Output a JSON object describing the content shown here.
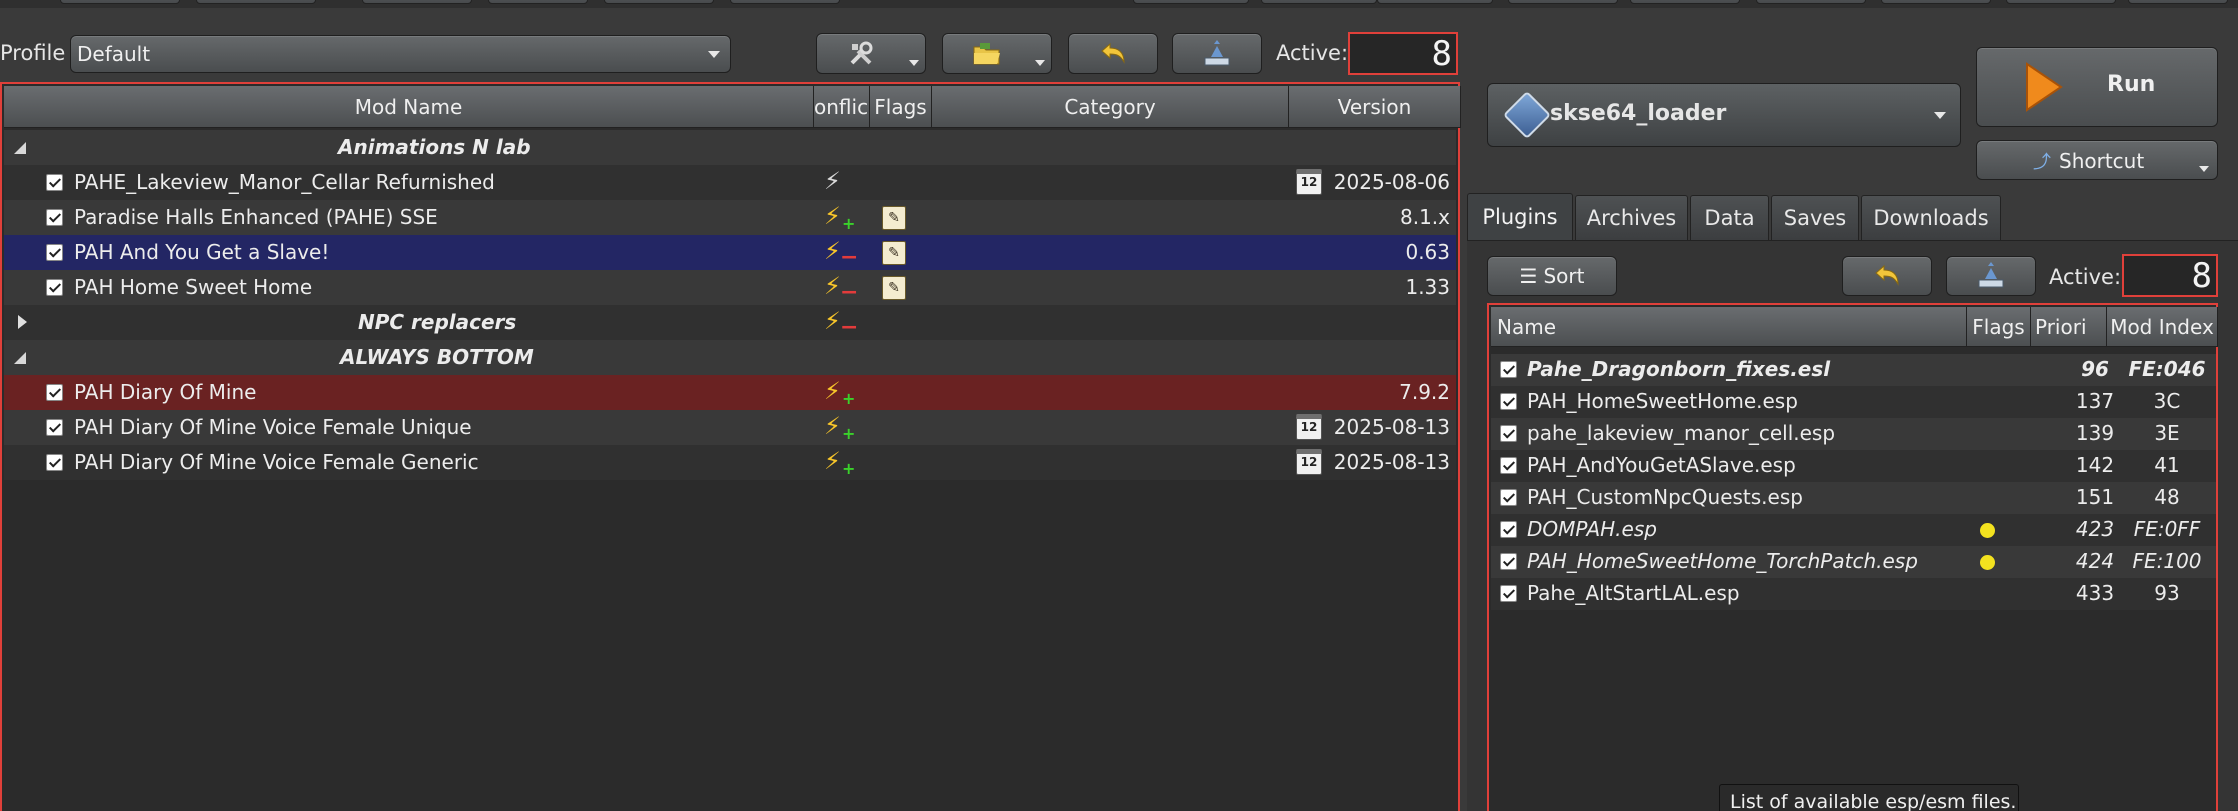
{
  "profile": {
    "label": "Profile",
    "selected": "Default"
  },
  "toolbar": {
    "tools_icon": "tools-icon",
    "folder_icon": "folder-icon",
    "undo_icon": "undo-arrow-icon",
    "backup_icon": "backup-icon",
    "active_label": "Active:",
    "active_count": "8"
  },
  "modlist": {
    "columns": [
      "Mod Name",
      "onflic",
      "Flags",
      "Category",
      "Version"
    ],
    "rows": [
      {
        "kind": "separator",
        "name": "Animations N lab",
        "expanded": true
      },
      {
        "kind": "mod",
        "name": "PAHE_Lakeview_Manor_Cellar Refurnished",
        "version": "2025-08-06",
        "conflict": "white",
        "calendar": true
      },
      {
        "kind": "mod",
        "name": "Paradise Halls Enhanced (PAHE) SSE",
        "version": "8.1.x",
        "conflict": "yellow-plus",
        "notes": true
      },
      {
        "kind": "mod",
        "name": "PAH And You Get a Slave!",
        "version": "0.63",
        "conflict": "yellow-minus",
        "notes": true,
        "selected": true
      },
      {
        "kind": "mod",
        "name": "PAH Home Sweet Home",
        "version": "1.33",
        "conflict": "yellow-minus",
        "notes": true
      },
      {
        "kind": "separator",
        "name": "NPC replacers",
        "expanded": false,
        "conflict": "yellow-minus"
      },
      {
        "kind": "separator",
        "name": "ALWAYS BOTTOM",
        "expanded": true
      },
      {
        "kind": "mod",
        "name": "PAH Diary Of Mine",
        "version": "7.9.2",
        "conflict": "yellow-plus",
        "highlight": true
      },
      {
        "kind": "mod",
        "name": "PAH Diary Of Mine Voice Female Unique",
        "version": "2025-08-13",
        "conflict": "yellow-plus",
        "calendar": true
      },
      {
        "kind": "mod",
        "name": "PAH Diary Of Mine Voice Female Generic",
        "version": "2025-08-13",
        "conflict": "yellow-plus",
        "calendar": true
      }
    ]
  },
  "executable": {
    "name": "skse64_loader",
    "run_label": "Run",
    "shortcut_label": "Shortcut"
  },
  "tabs": [
    "Plugins",
    "Archives",
    "Data",
    "Saves",
    "Downloads"
  ],
  "plugins_toolbar": {
    "sort_label": "Sort",
    "active_label": "Active:",
    "active_count": "8"
  },
  "plugins": {
    "columns": [
      "Name",
      "Flags",
      "Priori",
      "Mod Index"
    ],
    "rows": [
      {
        "name": "Pahe_Dragonborn_fixes.esl",
        "priority": "96",
        "index": "FE:046",
        "style": "bold-italic",
        "flag": false
      },
      {
        "name": "PAH_HomeSweetHome.esp",
        "priority": "137",
        "index": "3C",
        "style": "normal",
        "flag": false
      },
      {
        "name": "pahe_lakeview_manor_cell.esp",
        "priority": "139",
        "index": "3E",
        "style": "normal",
        "flag": false
      },
      {
        "name": "PAH_AndYouGetASlave.esp",
        "priority": "142",
        "index": "41",
        "style": "normal",
        "flag": false
      },
      {
        "name": "PAH_CustomNpcQuests.esp",
        "priority": "151",
        "index": "48",
        "style": "normal",
        "flag": false
      },
      {
        "name": "DOMPAH.esp",
        "priority": "423",
        "index": "FE:0FF",
        "style": "italic",
        "flag": true
      },
      {
        "name": "PAH_HomeSweetHome_TorchPatch.esp",
        "priority": "424",
        "index": "FE:100",
        "style": "italic",
        "flag": true
      },
      {
        "name": "Pahe_AltStartLAL.esp",
        "priority": "433",
        "index": "93",
        "style": "normal",
        "flag": false
      }
    ]
  },
  "tooltip": "List of available esp/esm files."
}
